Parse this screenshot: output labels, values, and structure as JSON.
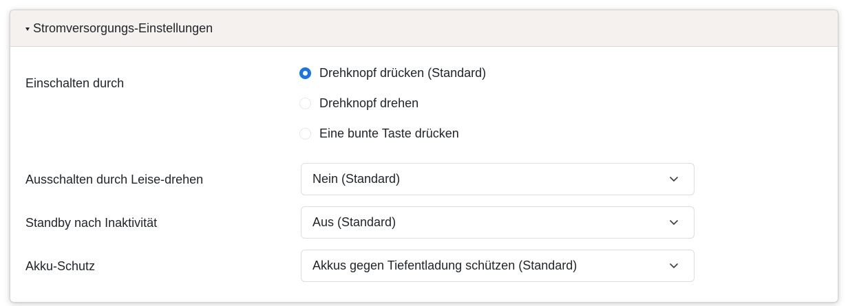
{
  "section": {
    "title": "Stromversorgungs-Einstellungen",
    "expanded": true
  },
  "power_on": {
    "label": "Einschalten durch",
    "options": [
      {
        "label": "Drehknopf drücken (Standard)",
        "selected": true
      },
      {
        "label": "Drehknopf drehen",
        "selected": false
      },
      {
        "label": "Eine bunte Taste drücken",
        "selected": false
      }
    ]
  },
  "power_off_volume": {
    "label": "Ausschalten durch Leise-drehen",
    "value": "Nein (Standard)"
  },
  "standby": {
    "label": "Standby nach Inaktivität",
    "value": "Aus (Standard)"
  },
  "battery_protection": {
    "label": "Akku-Schutz",
    "value": "Akkus gegen Tiefentladung schützen (Standard)"
  },
  "colors": {
    "accent": "#1a73e8",
    "header_bg": "#f4f1ee"
  },
  "icons": {
    "section_toggle": "caret-down-icon",
    "select_arrow": "chevron-down-icon"
  }
}
